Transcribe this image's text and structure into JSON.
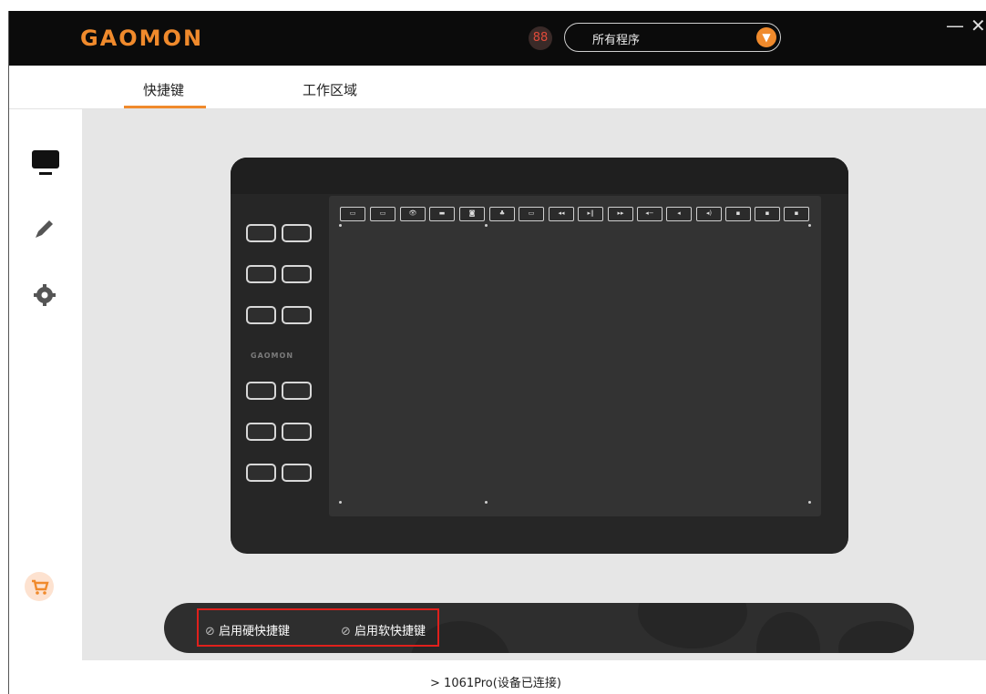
{
  "app": {
    "brand": "GAOMON",
    "mini_brand": "GAOMON"
  },
  "header": {
    "program_selector": {
      "value": "所有程序"
    },
    "minimize_label": "—",
    "close_label": "✕"
  },
  "tabs": [
    {
      "label": "快捷键",
      "active": true
    },
    {
      "label": "工作区域",
      "active": false
    }
  ],
  "sidebar": {
    "items": [
      {
        "icon": "monitor-icon",
        "active": true
      },
      {
        "icon": "pen-icon",
        "active": false
      },
      {
        "icon": "gear-icon",
        "active": false
      },
      {
        "icon": "cart-icon",
        "active": false
      }
    ]
  },
  "tablet": {
    "soft_keys": [
      "▭",
      "▭",
      "👁",
      "▬",
      "◙",
      "♣",
      "▭",
      "◂◂",
      "▸‖",
      "▸▸",
      "◂−",
      "◂",
      "◂)",
      "▪",
      "▪",
      "▪"
    ]
  },
  "options": {
    "hardware_shortcuts": "启用硬快捷键",
    "software_shortcuts": "启用软快捷键"
  },
  "status": {
    "device": "1061Pro(设备已连接)",
    "expand_icon": ">"
  },
  "colors": {
    "accent": "#f08a2c",
    "highlight": "#e0201c",
    "titlebar": "#0b0b0b"
  }
}
